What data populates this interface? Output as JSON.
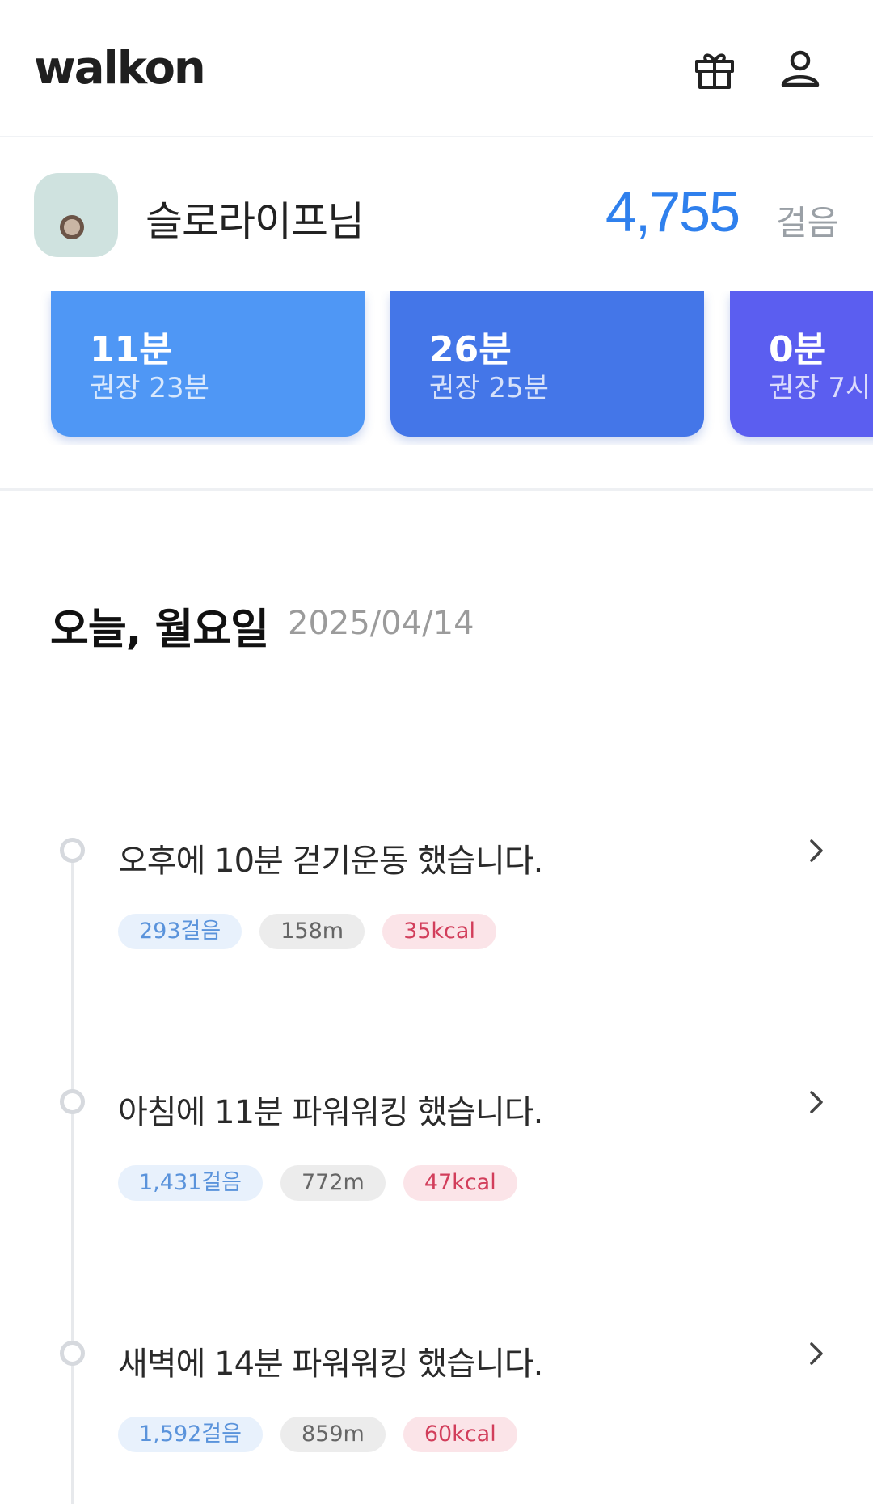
{
  "header": {
    "logo": "walkon",
    "icons": [
      "gift-icon",
      "user-icon"
    ]
  },
  "profile": {
    "nickname": "슬로라이프님",
    "steps": "4,755",
    "steps_unit": "걸음"
  },
  "cards": [
    {
      "value": "11분",
      "sub": "권장 23분",
      "color": "#4f97f5"
    },
    {
      "value": "26분",
      "sub": "권장 25분",
      "color": "#4476e8"
    },
    {
      "value": "0분",
      "sub": "권장 7시",
      "color": "#5b5ef0"
    }
  ],
  "date": {
    "heading": "오늘, 월요일",
    "value": "2025/04/14"
  },
  "activities": [
    {
      "title": "오후에 10분 걷기운동 했습니다.",
      "steps": "293걸음",
      "distance": "158m",
      "kcal": "35kcal"
    },
    {
      "title": "아침에 11분 파워워킹 했습니다.",
      "steps": "1,431걸음",
      "distance": "772m",
      "kcal": "47kcal"
    },
    {
      "title": "새벽에 14분 파워워킹 했습니다.",
      "steps": "1,592걸음",
      "distance": "859m",
      "kcal": "60kcal"
    }
  ],
  "colors": {
    "accent_blue": "#2f80ed",
    "chip_steps": "#5a93db",
    "chip_kcal": "#d23e5b"
  }
}
